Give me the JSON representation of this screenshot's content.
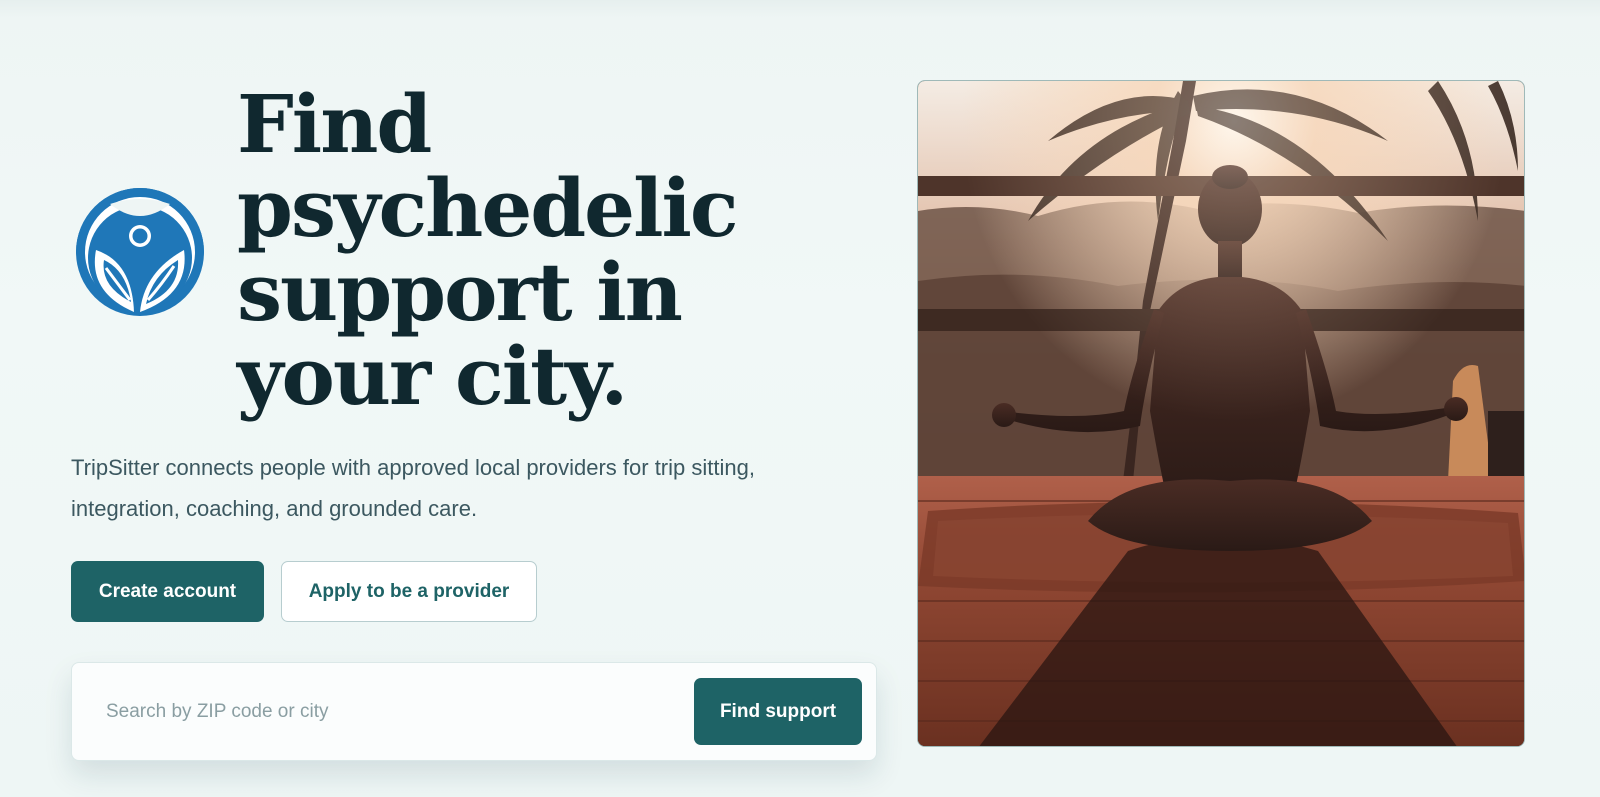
{
  "hero": {
    "headline_lines": [
      "Find",
      "psychedelic",
      "support in",
      "your city."
    ],
    "description": "TripSitter connects people with approved local providers for trip sitting, integration, coaching, and grounded care."
  },
  "actions": {
    "create_account": "Create account",
    "apply_provider": "Apply to be a provider"
  },
  "search": {
    "placeholder": "Search by ZIP code or city",
    "value": "",
    "button": "Find support"
  },
  "logo": {
    "icon": "leaf-person-logo-icon",
    "color": "#1f77b8"
  },
  "photo": {
    "subject": "meditation-silhouette-image"
  },
  "colors": {
    "accent": "#1e6366",
    "headline": "#10282f",
    "background": "#eef5f4"
  }
}
